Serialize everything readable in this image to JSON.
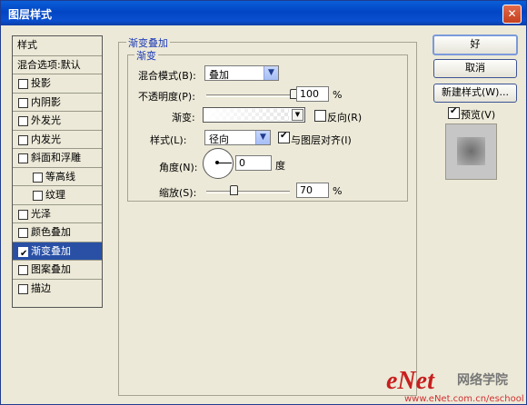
{
  "window": {
    "title": "图层样式",
    "close_glyph": "✕"
  },
  "sidebar": {
    "items": [
      {
        "label": "样式",
        "checkbox": false,
        "checked": false,
        "selected": false
      },
      {
        "label": "混合选项:默认",
        "checkbox": false,
        "checked": false,
        "selected": false
      },
      {
        "label": "投影",
        "checkbox": true,
        "checked": false,
        "selected": false
      },
      {
        "label": "内阴影",
        "checkbox": true,
        "checked": false,
        "selected": false
      },
      {
        "label": "外发光",
        "checkbox": true,
        "checked": false,
        "selected": false
      },
      {
        "label": "内发光",
        "checkbox": true,
        "checked": false,
        "selected": false
      },
      {
        "label": "斜面和浮雕",
        "checkbox": true,
        "checked": false,
        "selected": false
      },
      {
        "label": "等高线",
        "checkbox": true,
        "checked": false,
        "selected": false
      },
      {
        "label": "纹理",
        "checkbox": true,
        "checked": false,
        "selected": false
      },
      {
        "label": "光泽",
        "checkbox": true,
        "checked": false,
        "selected": false
      },
      {
        "label": "颜色叠加",
        "checkbox": true,
        "checked": false,
        "selected": false
      },
      {
        "label": "渐变叠加",
        "checkbox": true,
        "checked": true,
        "selected": true
      },
      {
        "label": "图案叠加",
        "checkbox": true,
        "checked": false,
        "selected": false
      },
      {
        "label": "描边",
        "checkbox": true,
        "checked": false,
        "selected": false
      }
    ]
  },
  "panel": {
    "group_title": "渐变叠加",
    "subgroup_title": "渐变",
    "blend_mode": {
      "label": "混合模式(B):",
      "value": "叠加"
    },
    "opacity": {
      "label": "不透明度(P):",
      "value": "100",
      "unit": "%",
      "level": 1.0
    },
    "gradient": {
      "label": "渐变:",
      "reverse_label": "反向(R)",
      "reverse_checked": false
    },
    "style": {
      "label": "样式(L):",
      "value": "径向",
      "align_label": "与图层对齐(I)",
      "align_checked": true
    },
    "angle": {
      "label": "角度(N):",
      "value": "0",
      "unit": "度"
    },
    "scale": {
      "label": "缩放(S):",
      "value": "70",
      "unit": "%",
      "level": 0.33
    }
  },
  "buttons": {
    "ok": "好",
    "cancel": "取消",
    "new_style": "新建样式(W)..."
  },
  "preview": {
    "label": "预览(V)",
    "checked": true
  },
  "watermark": {
    "brand": "eNet",
    "cn": "网络学院",
    "url": "www.eNet.com.cn/eschool"
  },
  "colors": {
    "title_bar": "#0245c4",
    "selected_row": "#2950a5",
    "legend_text": "#1937b4",
    "dialog_bg": "#ece9d8",
    "watermark_red": "#c81e1e"
  }
}
